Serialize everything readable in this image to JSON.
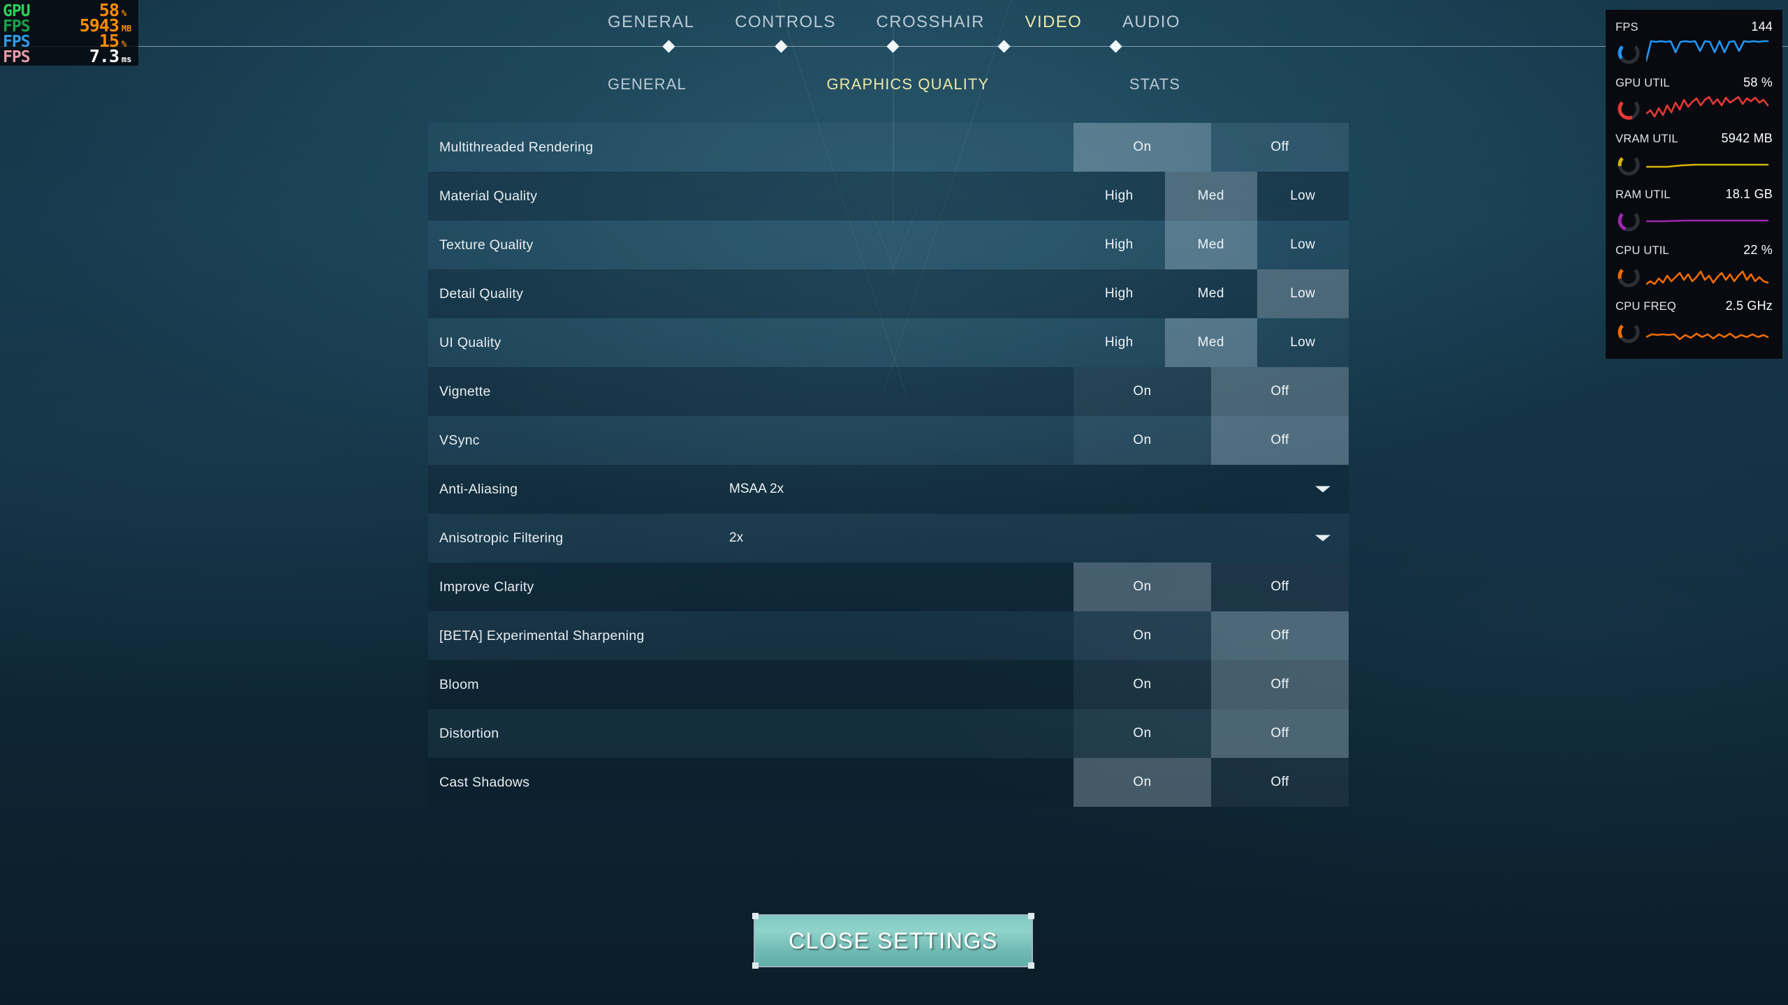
{
  "perf_overlay": {
    "rows": [
      {
        "label": "GPU",
        "label_color": "#2fcf5a",
        "value": "58",
        "unit": "%",
        "white": false
      },
      {
        "label": "FPS",
        "label_color": "#17a348",
        "value": "5943",
        "unit": "MB",
        "white": false
      },
      {
        "label": "FPS",
        "label_color": "#2f9ce8",
        "value": "15",
        "unit": "%",
        "white": false
      },
      {
        "label": "FPS",
        "label_color": "#e79aa4",
        "value": "7.3",
        "unit": "ms",
        "white": true
      }
    ]
  },
  "nav": {
    "tabs": [
      {
        "label": "GENERAL",
        "active": false
      },
      {
        "label": "CONTROLS",
        "active": false
      },
      {
        "label": "CROSSHAIR",
        "active": false
      },
      {
        "label": "VIDEO",
        "active": true
      },
      {
        "label": "AUDIO",
        "active": false
      }
    ],
    "subtabs": [
      {
        "label": "GENERAL",
        "active": false
      },
      {
        "label": "GRAPHICS QUALITY",
        "active": true
      },
      {
        "label": "STATS",
        "active": false
      }
    ],
    "active_color": "#ece8a6",
    "inactive_color": "#b9c9d4"
  },
  "settings": {
    "rows": [
      {
        "label": "Multithreaded Rendering",
        "type": "toggle",
        "options": [
          "On",
          "Off"
        ],
        "selected": 0
      },
      {
        "label": "Material Quality",
        "type": "triple",
        "options": [
          "High",
          "Med",
          "Low"
        ],
        "selected": 1
      },
      {
        "label": "Texture Quality",
        "type": "triple",
        "options": [
          "High",
          "Med",
          "Low"
        ],
        "selected": 1
      },
      {
        "label": "Detail Quality",
        "type": "triple",
        "options": [
          "High",
          "Med",
          "Low"
        ],
        "selected": 2
      },
      {
        "label": "UI Quality",
        "type": "triple",
        "options": [
          "High",
          "Med",
          "Low"
        ],
        "selected": 1
      },
      {
        "label": "Vignette",
        "type": "toggle",
        "options": [
          "On",
          "Off"
        ],
        "selected": 1
      },
      {
        "label": "VSync",
        "type": "toggle",
        "options": [
          "On",
          "Off"
        ],
        "selected": 1
      },
      {
        "label": "Anti-Aliasing",
        "type": "dropdown",
        "value": "MSAA 2x"
      },
      {
        "label": "Anisotropic Filtering",
        "type": "dropdown",
        "value": "2x"
      },
      {
        "label": "Improve Clarity",
        "type": "toggle",
        "options": [
          "On",
          "Off"
        ],
        "selected": 0
      },
      {
        "label": "[BETA] Experimental Sharpening",
        "type": "toggle",
        "options": [
          "On",
          "Off"
        ],
        "selected": 1
      },
      {
        "label": "Bloom",
        "type": "toggle",
        "options": [
          "On",
          "Off"
        ],
        "selected": 1
      },
      {
        "label": "Distortion",
        "type": "toggle",
        "options": [
          "On",
          "Off"
        ],
        "selected": 1
      },
      {
        "label": "Cast Shadows",
        "type": "toggle",
        "options": [
          "On",
          "Off"
        ],
        "selected": 0
      }
    ]
  },
  "close_button": {
    "label": "CLOSE SETTINGS",
    "accent": "#7fc9c2"
  },
  "stats_panel": {
    "items": [
      {
        "key": "FPS",
        "value": "144",
        "color": "#2196f3",
        "spark": "0,34 7,6 14,7 21,6 28,7 35,6 42,22 49,7 56,6 63,7 70,6 77,20 84,6 91,7 98,22 105,6 112,22 119,7 126,6 133,20 140,6 147,7 154,6 161,7 168,6 174,6",
        "dial_pct": 0.3
      },
      {
        "key": "GPU UTIL",
        "value": "58 %",
        "color": "#e53935",
        "spark": "0,30 6,25 12,34 18,22 24,32 30,18 36,28 42,14 48,24 54,10 60,20 66,13 72,8 78,18 84,10 90,6 96,16 102,9 108,18 114,7 120,14 126,10 132,6 138,16 144,8 150,12 156,7 162,14 168,10 174,18",
        "dial_pct": 0.58
      },
      {
        "key": "VRAM UTIL",
        "value": "5942 MB",
        "color": "#d4b400",
        "spark": "0,26 30,26 50,24 70,23 100,23 130,23 160,23 174,23",
        "dial_pct": 0.2
      },
      {
        "key": "RAM UTIL",
        "value": "18.1 GB",
        "color": "#9c27b0",
        "spark": "0,24 25,24 55,23 85,23 115,23 145,23 174,23",
        "dial_pct": 0.42
      },
      {
        "key": "CPU UTIL",
        "value": "22 %",
        "color": "#ef6c00",
        "spark": "0,34 6,30 12,34 18,26 24,32 30,22 36,30 42,24 48,18 54,28 60,20 66,30 72,24 78,16 84,28 90,22 96,32 102,24 108,18 114,28 120,20 126,30 132,22 138,16 144,28 150,20 156,30 162,24 168,30 174,32",
        "dial_pct": 0.22
      },
      {
        "key": "CPU FREQ",
        "value": "2.5 GHz",
        "color": "#ef6c00",
        "spark": "0,30 8,26 16,27 24,26 32,27 40,26 48,33 56,27 64,31 72,25 80,30 88,26 96,32 104,26 112,30 120,25 128,31 136,27 144,30 152,26 160,30 168,27 174,30",
        "dial_pct": 0.3
      }
    ]
  }
}
